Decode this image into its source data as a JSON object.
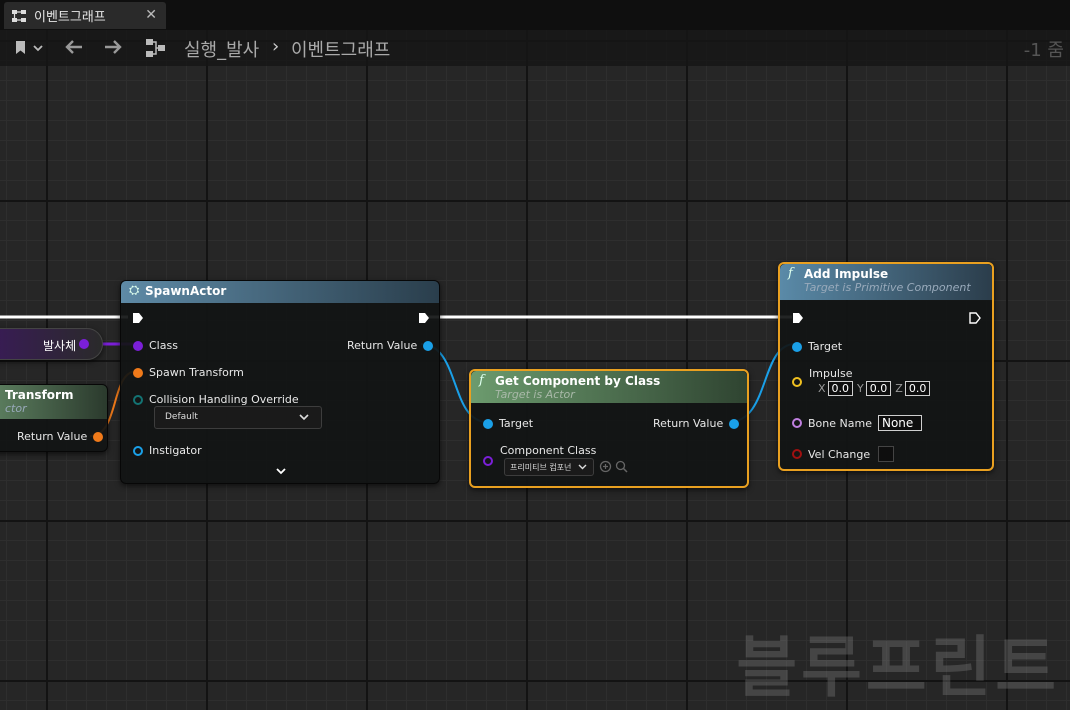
{
  "tab": {
    "label": "이벤트그래프",
    "close": "✕"
  },
  "breadcrumb": {
    "graph": "실행_발사",
    "separator": "›",
    "current": "이벤트그래프",
    "zoom": "-1 줌"
  },
  "watermark": "블루프린트",
  "nodes": {
    "projectile_var": {
      "label": "발사체"
    },
    "transform": {
      "title": "Transform",
      "subtitle": "ctor",
      "return_label": "Return Value"
    },
    "spawn_actor": {
      "title": "SpawnActor",
      "pin_class": "Class",
      "pin_spawn_transform": "Spawn Transform",
      "pin_collision": "Collision Handling Override",
      "collision_value": "Default",
      "pin_instigator": "Instigator",
      "return_label": "Return Value"
    },
    "get_component": {
      "title": "Get Component by Class",
      "subtitle": "Target is Actor",
      "pin_target": "Target",
      "pin_component_class": "Component Class",
      "component_class_value": "프리미티브 컴포넌",
      "return_label": "Return Value"
    },
    "add_impulse": {
      "title": "Add Impulse",
      "subtitle": "Target is Primitive Component",
      "pin_target": "Target",
      "pin_impulse": "Impulse",
      "x_label": "X",
      "x_value": "0.0",
      "y_label": "Y",
      "y_value": "0.0",
      "z_label": "Z",
      "z_value": "0.0",
      "pin_bone_name": "Bone Name",
      "bone_name_value": "None",
      "pin_vel_change": "Vel Change"
    }
  },
  "colors": {
    "exec": "#ffffff",
    "object_pin": "#1aa0e8",
    "class_pin": "#7b1fd8",
    "struct_pin": "#f07a1a",
    "vector_pin": "#f0c020",
    "name_pin": "#c080e0",
    "bool_pin": "#a01010",
    "selection": "#e9a020"
  }
}
